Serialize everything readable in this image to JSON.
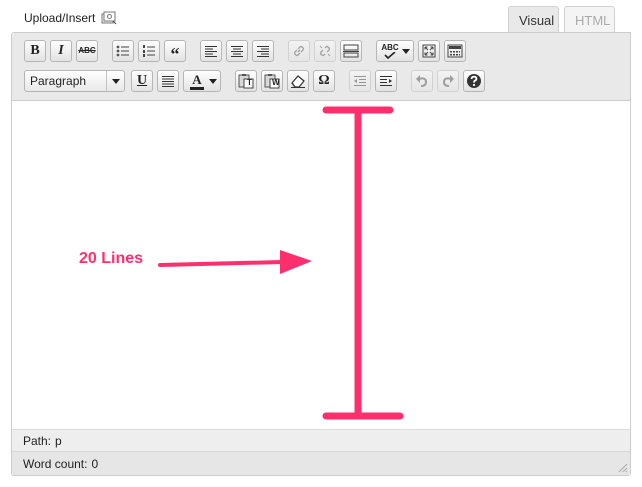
{
  "header": {
    "upload_insert_label": "Upload/Insert",
    "media_icon": "add-media-icon"
  },
  "tabs": [
    {
      "label": "Visual",
      "active": true
    },
    {
      "label": "HTML",
      "active": false
    }
  ],
  "toolbar": {
    "row1": [
      {
        "name": "bold",
        "glyph": "B"
      },
      {
        "name": "italic",
        "glyph": "I"
      },
      {
        "name": "strikethrough",
        "glyph": "ABC"
      },
      {
        "name": "bulleted-list",
        "icon": "bulleted-list-icon"
      },
      {
        "name": "numbered-list",
        "icon": "numbered-list-icon"
      },
      {
        "name": "blockquote",
        "glyph": "“"
      },
      {
        "name": "align-left",
        "icon": "align-left-icon"
      },
      {
        "name": "align-center",
        "icon": "align-center-icon"
      },
      {
        "name": "align-right",
        "icon": "align-right-icon"
      },
      {
        "name": "insert-link",
        "icon": "link-icon",
        "disabled": true
      },
      {
        "name": "unlink",
        "icon": "unlink-icon",
        "disabled": true
      },
      {
        "name": "insert-more",
        "icon": "more-tag-icon"
      },
      {
        "name": "spellcheck",
        "glyph": "ABC"
      },
      {
        "name": "fullscreen",
        "icon": "fullscreen-icon"
      },
      {
        "name": "kitchen-sink",
        "icon": "kitchen-sink-icon"
      }
    ],
    "row2": [
      {
        "name": "format",
        "value": "Paragraph"
      },
      {
        "name": "underline",
        "glyph": "U"
      },
      {
        "name": "justify",
        "icon": "justify-icon"
      },
      {
        "name": "text-color",
        "glyph": "A"
      },
      {
        "name": "paste-text",
        "glyph": "T"
      },
      {
        "name": "paste-word",
        "glyph": "W"
      },
      {
        "name": "remove-format",
        "icon": "eraser-icon"
      },
      {
        "name": "special-char",
        "glyph": "Ω"
      },
      {
        "name": "outdent",
        "icon": "outdent-icon",
        "disabled": true
      },
      {
        "name": "indent",
        "icon": "indent-icon"
      },
      {
        "name": "undo",
        "icon": "undo-icon",
        "disabled": true
      },
      {
        "name": "redo",
        "icon": "redo-icon",
        "disabled": true
      },
      {
        "name": "help",
        "icon": "help-icon"
      }
    ]
  },
  "content": {
    "annotation_label": "20 Lines",
    "annotation_color": "#ff2f6e"
  },
  "status": {
    "path_label": "Path:",
    "path_value": "p",
    "word_count_label": "Word count:",
    "word_count_value": "0"
  }
}
